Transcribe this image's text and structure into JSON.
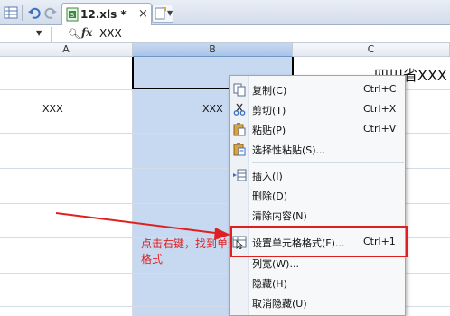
{
  "tabbar": {
    "file_tab_label": "12.xls *",
    "close_glyph": "×",
    "icons": [
      "grid-icon",
      "undo-icon",
      "redo-icon",
      "excel-file-icon",
      "new-tab-icon"
    ]
  },
  "formula_bar": {
    "value": "XXX",
    "icons": [
      "zoom-icon",
      "fx-icon"
    ]
  },
  "columns": [
    "A",
    "B",
    "C"
  ],
  "cells": {
    "a2": "XXX",
    "b2": "XXX",
    "c1": "四川省XXX"
  },
  "context_menu": {
    "items": [
      {
        "label": "复制(C)",
        "shortcut": "Ctrl+C",
        "icon": "copy-icon"
      },
      {
        "label": "剪切(T)",
        "shortcut": "Ctrl+X",
        "icon": "cut-icon"
      },
      {
        "label": "粘贴(P)",
        "shortcut": "Ctrl+V",
        "icon": "paste-icon"
      },
      {
        "label": "选择性粘贴(S)...",
        "shortcut": "",
        "icon": "paste-special-icon"
      },
      {
        "label": "插入(I)",
        "shortcut": "",
        "icon": "insert-icon"
      },
      {
        "label": "删除(D)",
        "shortcut": "",
        "icon": ""
      },
      {
        "label": "清除内容(N)",
        "shortcut": "",
        "icon": ""
      },
      {
        "label": "设置单元格格式(F)...",
        "shortcut": "Ctrl+1",
        "icon": "format-cells-icon"
      },
      {
        "label": "列宽(W)...",
        "shortcut": "",
        "icon": ""
      },
      {
        "label": "隐藏(H)",
        "shortcut": "",
        "icon": ""
      },
      {
        "label": "取消隐藏(U)",
        "shortcut": "",
        "icon": ""
      }
    ]
  },
  "annotation": {
    "text": "点击右键，找到单元格格式",
    "color": "#e02020"
  },
  "colors": {
    "selection": "#c6d9f1",
    "header_selected": "#a9c4e8",
    "annotation_red": "#e02020"
  }
}
